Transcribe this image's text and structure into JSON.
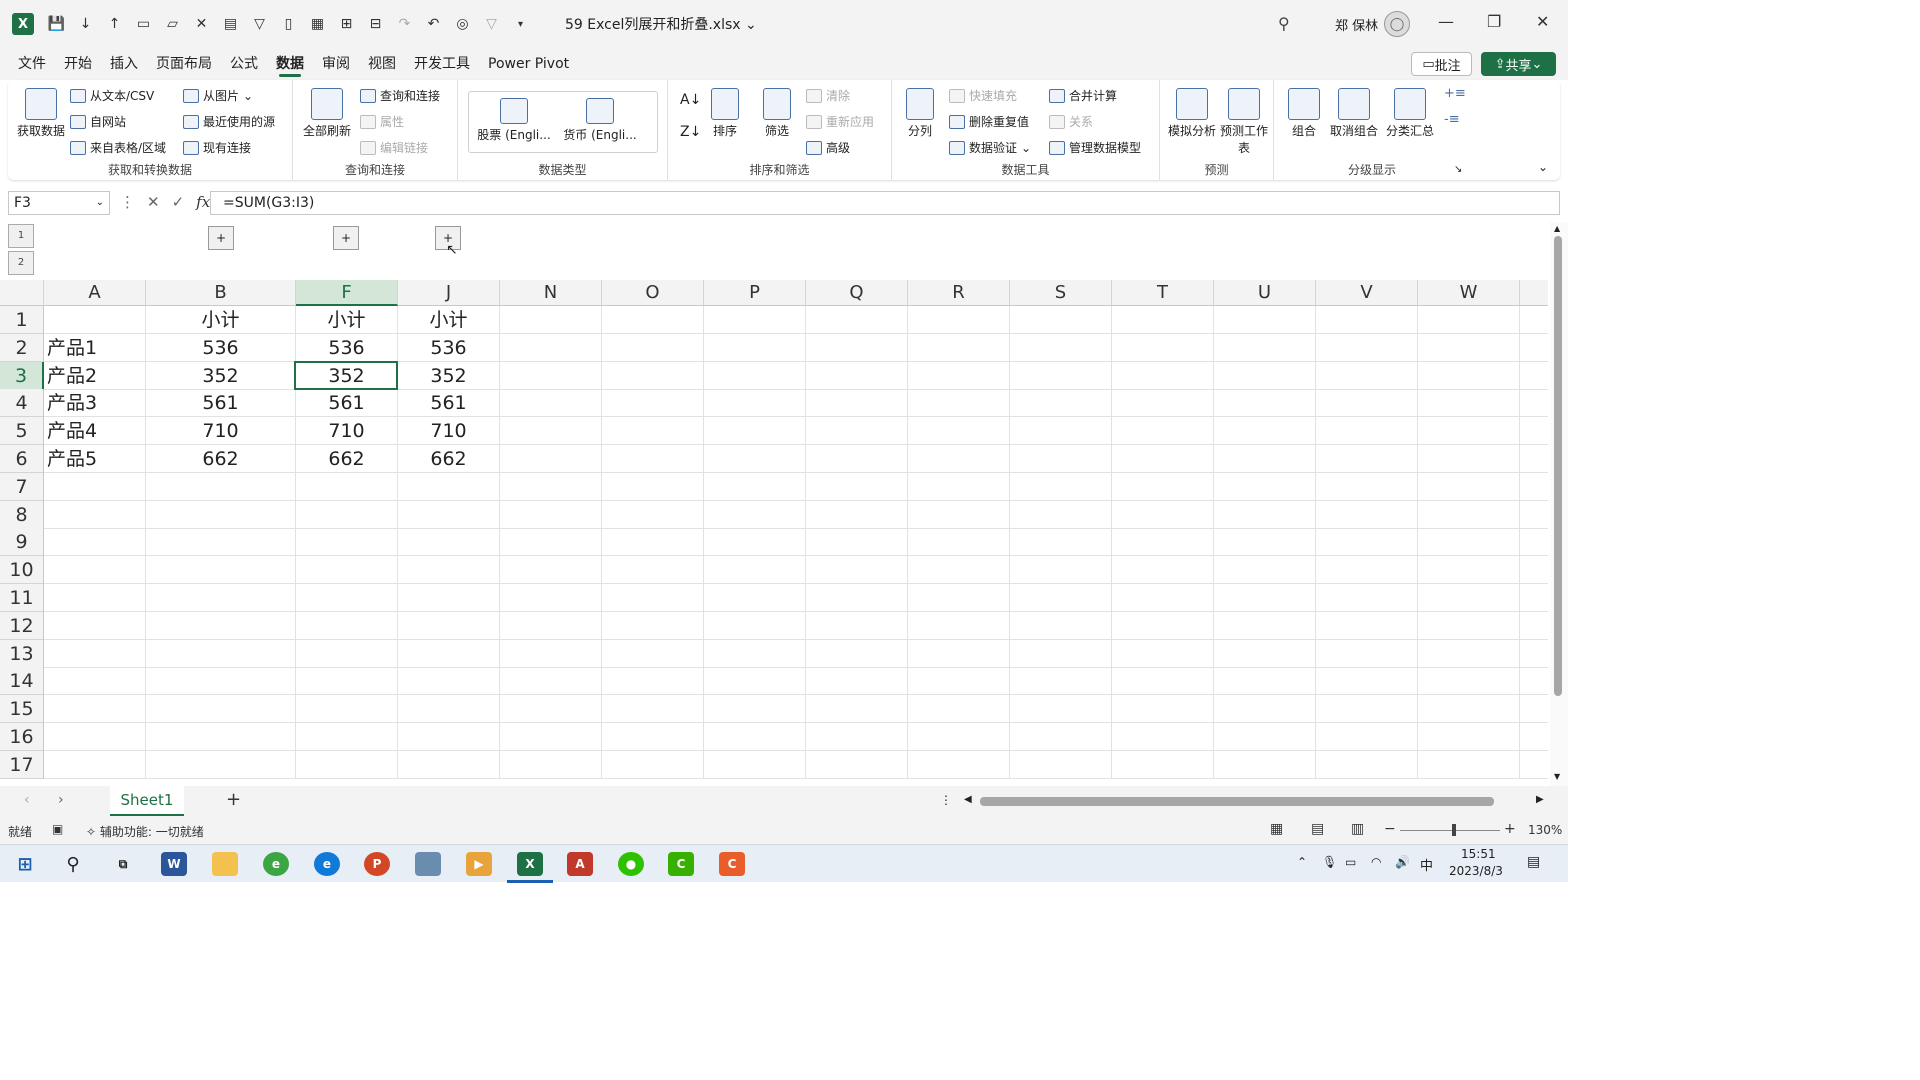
{
  "window": {
    "title": "59 Excel列展开和折叠.xlsx",
    "user": "郑 保林"
  },
  "menu": [
    "文件",
    "开始",
    "插入",
    "页面布局",
    "公式",
    "数据",
    "审阅",
    "视图",
    "开发工具",
    "Power Pivot"
  ],
  "active_menu": "数据",
  "buttons": {
    "comment": "批注",
    "share": "共享"
  },
  "ribbon": {
    "get_data": {
      "big": "获取数据",
      "items": [
        "从文本/CSV",
        "自网站",
        "来自表格/区域",
        "从图片",
        "最近使用的源",
        "现有连接"
      ],
      "label": "获取和转换数据"
    },
    "queries": {
      "big": "全部刷新",
      "items": [
        "查询和连接",
        "属性",
        "编辑链接"
      ],
      "label": "查询和连接"
    },
    "datatypes": {
      "items": [
        "股票 (Engli...",
        "货币 (Engli..."
      ],
      "label": "数据类型"
    },
    "sort": {
      "items": [
        "排序",
        "筛选",
        "清除",
        "重新应用",
        "高级"
      ],
      "label": "排序和筛选"
    },
    "tools": {
      "items": [
        "分列",
        "快速填充",
        "删除重复值",
        "数据验证",
        "合并计算",
        "关系",
        "管理数据模型"
      ],
      "label": "数据工具"
    },
    "forecast": {
      "items": [
        "模拟分析",
        "预测工作表"
      ],
      "label": "预测"
    },
    "outline": {
      "items": [
        "组合",
        "取消组合",
        "分类汇总"
      ],
      "label": "分级显示"
    }
  },
  "formula_bar": {
    "name_box": "F3",
    "formula": "=SUM(G3:I3)",
    "fx": "fx"
  },
  "outline_levels": [
    "1",
    "2"
  ],
  "grid": {
    "columns": [
      "A",
      "B",
      "F",
      "J",
      "N",
      "O",
      "P",
      "Q",
      "R",
      "S",
      "T",
      "U",
      "V",
      "W"
    ],
    "selected_column": "F",
    "rows": [
      "1",
      "2",
      "3",
      "4",
      "5",
      "6",
      "7",
      "8",
      "9",
      "10",
      "11",
      "12",
      "13",
      "14",
      "15",
      "16",
      "17"
    ],
    "selected_row": "3",
    "data": [
      [
        "",
        "小计",
        "小计",
        "小计"
      ],
      [
        "产品1",
        "536",
        "536",
        "536"
      ],
      [
        "产品2",
        "352",
        "352",
        "352"
      ],
      [
        "产品3",
        "561",
        "561",
        "561"
      ],
      [
        "产品4",
        "710",
        "710",
        "710"
      ],
      [
        "产品5",
        "662",
        "662",
        "662"
      ]
    ]
  },
  "sheet_tab": "Sheet1",
  "status": {
    "ready": "就绪",
    "accessibility": "辅助功能: 一切就绪",
    "zoom": "130%"
  },
  "taskbar": {
    "time": "15:51",
    "date": "2023/8/3",
    "ime": "中"
  }
}
